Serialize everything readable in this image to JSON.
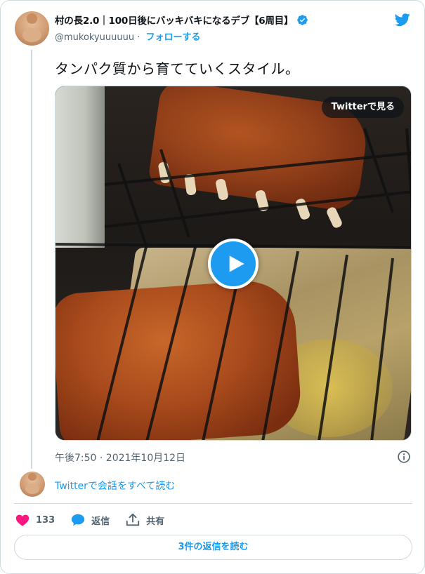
{
  "author": {
    "display_name": "村の長2.0｜100日後にバッキバキになるデブ【6周目】",
    "handle": "@mukokyuuuuuu",
    "separator": "·",
    "follow_label": "フォローする"
  },
  "tweet": {
    "text": "タンパク質から育てていくスタイル。",
    "timestamp": "午後7:50 · 2021年10月12日"
  },
  "media": {
    "watch_on_twitter_label": "Twitterで見る"
  },
  "conversation": {
    "link_label": "Twitterで会話をすべて読む"
  },
  "actions": {
    "like_count": "133",
    "reply_label": "返信",
    "share_label": "共有"
  },
  "replies_button": {
    "label": "3件の返信を読む"
  },
  "colors": {
    "accent": "#1d9bf0",
    "like": "#f91880",
    "secondary_text": "#536471",
    "border": "#cfd9de"
  },
  "icons": {
    "brand": "twitter-bird-icon",
    "verified": "verified-badge-icon",
    "play": "play-icon",
    "info": "info-icon",
    "like": "heart-icon",
    "reply": "speech-bubble-icon",
    "share": "share-upload-icon"
  }
}
